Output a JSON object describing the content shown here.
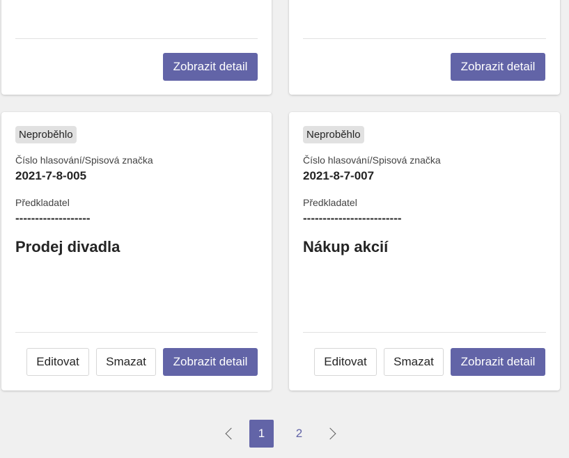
{
  "top_cards": [
    {
      "detail_label": "Zobrazit detail"
    },
    {
      "detail_label": "Zobrazit detail"
    }
  ],
  "cards": [
    {
      "status": "Neproběhlo",
      "number_label": "Číslo hlasování/Spisová značka",
      "number_value": "2021-7-8-005",
      "submitter_label": "Předkladatel",
      "submitter_value": "-------------------",
      "title": "Prodej divadla",
      "edit_label": "Editovat",
      "delete_label": "Smazat",
      "detail_label": "Zobrazit detail"
    },
    {
      "status": "Neproběhlo",
      "number_label": "Číslo hlasování/Spisová značka",
      "number_value": "2021-8-7-007",
      "submitter_label": "Předkladatel",
      "submitter_value": "-------------------------",
      "title": "Nákup akcií",
      "edit_label": "Editovat",
      "delete_label": "Smazat",
      "detail_label": "Zobrazit detail"
    }
  ],
  "pagination": {
    "pages": [
      "1",
      "2"
    ],
    "current": "1",
    "prev_icon": "chevron-left-icon",
    "next_icon": "chevron-right-icon"
  },
  "colors": {
    "accent": "#6264a7",
    "background": "#f0f0f0",
    "badge": "#e1e1e1"
  }
}
